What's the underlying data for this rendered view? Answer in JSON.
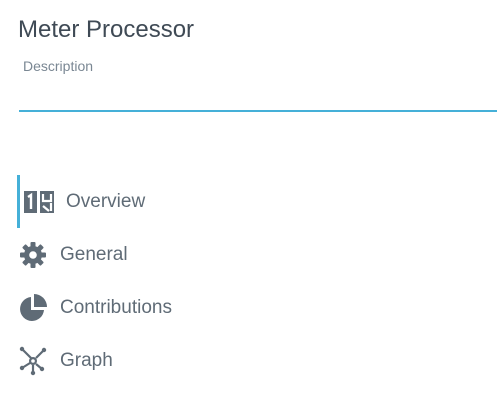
{
  "header": {
    "title": "Meter Processor"
  },
  "description_field": {
    "label": "Description",
    "value": "",
    "accent_color": "#45b0d8"
  },
  "nav": {
    "items": [
      {
        "label": "Overview",
        "icon": "overview-counter-icon",
        "active": true
      },
      {
        "label": "General",
        "icon": "gear-icon",
        "active": false
      },
      {
        "label": "Contributions",
        "icon": "pie-chart-icon",
        "active": false
      },
      {
        "label": "Graph",
        "icon": "network-graph-icon",
        "active": false
      }
    ]
  },
  "colors": {
    "icon": "#5f6b76",
    "text": "#5f6b76",
    "title": "#3f4a55",
    "accent": "#45b0d8"
  }
}
